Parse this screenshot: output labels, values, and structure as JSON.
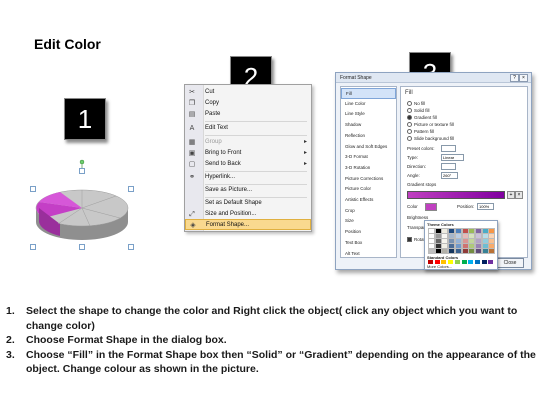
{
  "title": "Edit Color",
  "step_badges": [
    "1",
    "2",
    "3"
  ],
  "colors": {
    "pie_accent": "#c43fc6",
    "pie_base": "#b8b8b8",
    "menu_highlight": "#f9d98f",
    "grad_start": "#c040c0",
    "grad_end": "#8000a0"
  },
  "context_menu": {
    "items": [
      {
        "label": "Cut",
        "icon": "scissors-icon"
      },
      {
        "label": "Copy",
        "icon": "copy-icon"
      },
      {
        "label": "Paste",
        "icon": "paste-icon"
      },
      {
        "label": "Edit Text",
        "icon": "edit-text-icon"
      },
      {
        "label": "Group",
        "icon": "group-icon",
        "disabled": true,
        "submenu": true
      },
      {
        "label": "Bring to Front",
        "icon": "bring-front-icon",
        "submenu": true
      },
      {
        "label": "Send to Back",
        "icon": "send-back-icon",
        "submenu": true
      },
      {
        "label": "Hyperlink...",
        "icon": "hyperlink-icon"
      },
      {
        "label": "Save as Picture...",
        "icon": ""
      },
      {
        "label": "Set as Default Shape",
        "icon": ""
      },
      {
        "label": "Size and Position...",
        "icon": "size-icon"
      },
      {
        "label": "Format Shape...",
        "icon": "format-shape-icon",
        "highlighted": true
      }
    ]
  },
  "format_dialog": {
    "title": "Format Shape",
    "categories": [
      "Fill",
      "Line Color",
      "Line Style",
      "Shadow",
      "Reflection",
      "Glow and Soft Edges",
      "3-D Format",
      "3-D Rotation",
      "Picture Corrections",
      "Picture Color",
      "Artistic Effects",
      "Crop",
      "Size",
      "Position",
      "Text Box",
      "Alt Text"
    ],
    "pane_title": "Fill",
    "fill_options": [
      "No fill",
      "Solid fill",
      "Gradient fill",
      "Picture or texture fill",
      "Pattern fill",
      "Slide background fill"
    ],
    "selected_fill": "Gradient fill",
    "fields": {
      "preset_colors": "Preset colors:",
      "type_label": "Type:",
      "type_value": "Linear",
      "direction_label": "Direction:",
      "angle_label": "Angle:",
      "angle_value": "260°",
      "gradient_stops": "Gradient stops",
      "color_label": "Color",
      "position_label": "Position:",
      "position_value": "100%",
      "brightness_label": "Brightness",
      "transparency_label": "Transparency",
      "rotate_label": "Rotate"
    },
    "close_label": "Close"
  },
  "color_popup": {
    "theme_title": "Theme Colors",
    "standard_title": "Standard Colors",
    "more_colors": "More Colors...",
    "theme_top": [
      "#ffffff",
      "#000000",
      "#eeece1",
      "#1f497d",
      "#4f81bd",
      "#c0504d",
      "#9bbb59",
      "#8064a2",
      "#4bacc6",
      "#f79646"
    ],
    "standard": [
      "#c00000",
      "#ff0000",
      "#ffc000",
      "#ffff00",
      "#92d050",
      "#00b050",
      "#00b0f0",
      "#0070c0",
      "#002060",
      "#7030a0"
    ]
  },
  "instructions": [
    {
      "num": "1.",
      "text": "Select the shape to change the color and Right click the object( click any object which you want to change color)"
    },
    {
      "num": "2.",
      "text": "Choose Format Shape in the dialog box."
    },
    {
      "num": "3.",
      "text": "Choose “Fill” in the Format Shape box then “Solid” or “Gradient” depending on the appearance of the object. Change colour as shown in the picture."
    }
  ]
}
